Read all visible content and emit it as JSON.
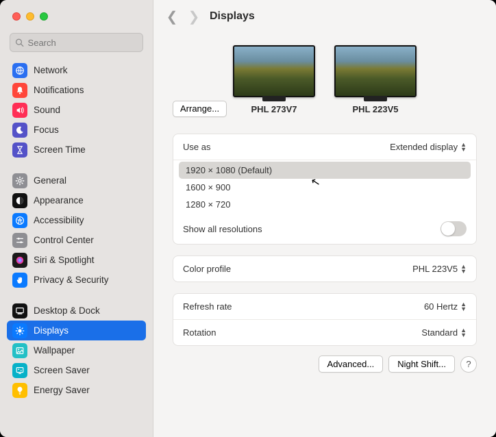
{
  "search": {
    "placeholder": "Search"
  },
  "sidebar": {
    "groups": [
      [
        {
          "label": "Network",
          "color": "#2a6ff1",
          "glyph": "globe"
        },
        {
          "label": "Notifications",
          "color": "#ff463a",
          "glyph": "bell"
        },
        {
          "label": "Sound",
          "color": "#ff2e55",
          "glyph": "speaker"
        },
        {
          "label": "Focus",
          "color": "#5452c8",
          "glyph": "moon"
        },
        {
          "label": "Screen Time",
          "color": "#5452c8",
          "glyph": "hourglass"
        }
      ],
      [
        {
          "label": "General",
          "color": "#8e8e93",
          "glyph": "gear"
        },
        {
          "label": "Appearance",
          "color": "#111111",
          "glyph": "appearance"
        },
        {
          "label": "Accessibility",
          "color": "#0a7aff",
          "glyph": "access"
        },
        {
          "label": "Control Center",
          "color": "#8e8e93",
          "glyph": "sliders"
        },
        {
          "label": "Siri & Spotlight",
          "color": "#1a1a1a",
          "glyph": "siri"
        },
        {
          "label": "Privacy & Security",
          "color": "#0a7aff",
          "glyph": "hand"
        }
      ],
      [
        {
          "label": "Desktop & Dock",
          "color": "#111111",
          "glyph": "dock"
        },
        {
          "label": "Displays",
          "color": "#0a7aff",
          "glyph": "sun",
          "active": true
        },
        {
          "label": "Wallpaper",
          "color": "#23c0c6",
          "glyph": "wallpaper"
        },
        {
          "label": "Screen Saver",
          "color": "#06b1c8",
          "glyph": "screensaver"
        },
        {
          "label": "Energy Saver",
          "color": "#ffbf00",
          "glyph": "bulb"
        }
      ]
    ]
  },
  "page": {
    "title": "Displays",
    "arrange_label": "Arrange...",
    "monitors": [
      {
        "name": "PHL 273V7"
      },
      {
        "name": "PHL 223V5",
        "selected": true
      }
    ],
    "use_as": {
      "label": "Use as",
      "value": "Extended display"
    },
    "resolutions": [
      {
        "label": "1920 × 1080 (Default)",
        "selected": true
      },
      {
        "label": "1600 × 900"
      },
      {
        "label": "1280 × 720"
      }
    ],
    "show_all": {
      "label": "Show all resolutions",
      "on": false
    },
    "color_profile": {
      "label": "Color profile",
      "value": "PHL 223V5"
    },
    "refresh_rate": {
      "label": "Refresh rate",
      "value": "60 Hertz"
    },
    "rotation": {
      "label": "Rotation",
      "value": "Standard"
    },
    "buttons": {
      "advanced": "Advanced...",
      "night_shift": "Night Shift...",
      "help": "?"
    }
  }
}
